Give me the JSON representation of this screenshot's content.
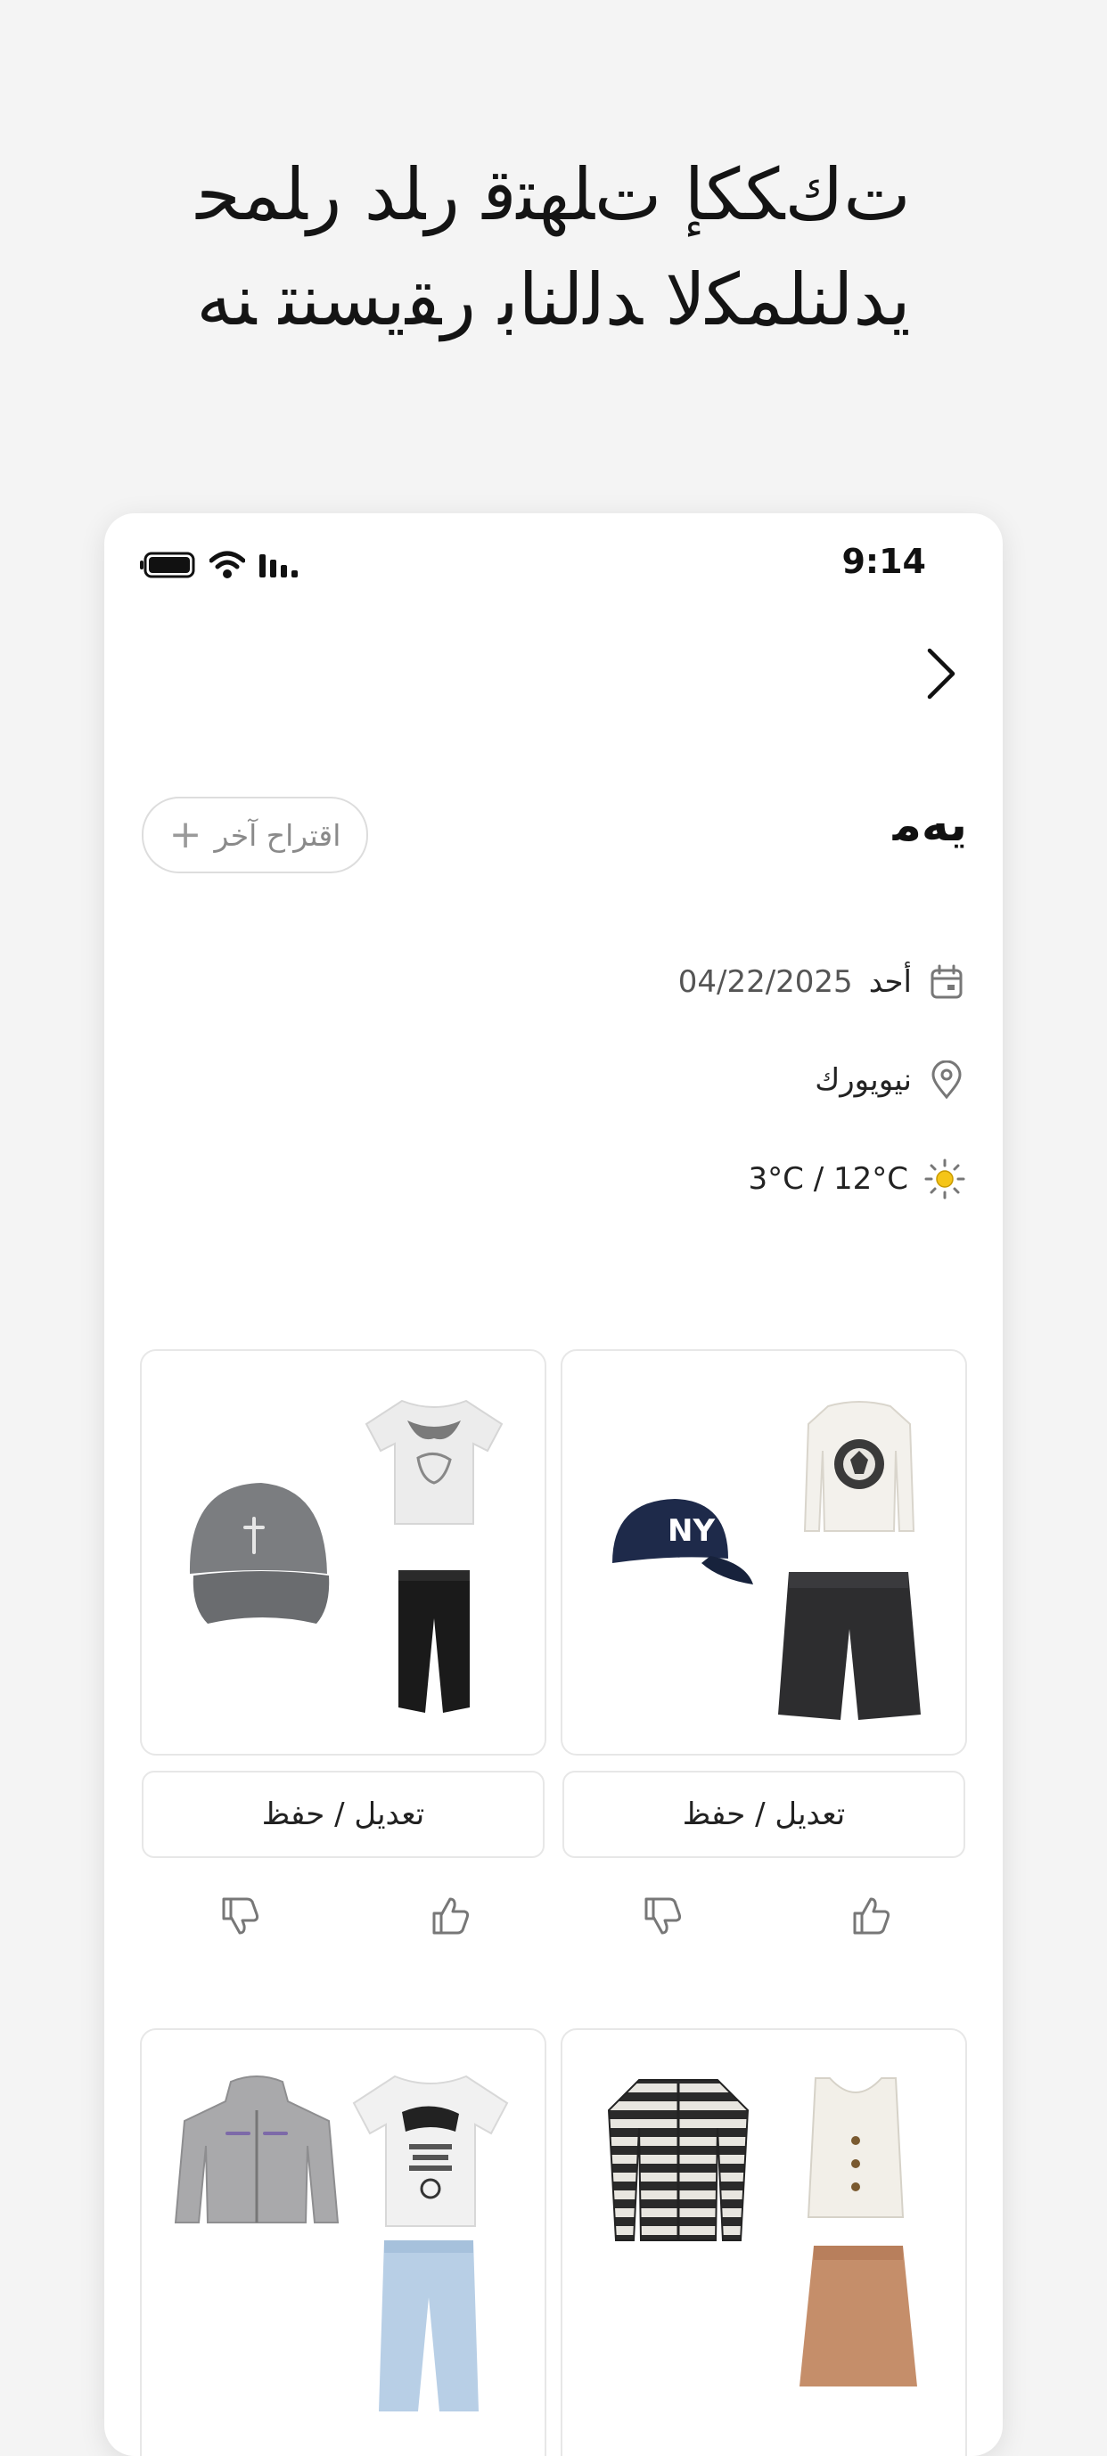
{
  "headline": {
    "line1": "ﺕﻙﻜﻜﺈ ﺕﻠﻬﺘﻗ ﺭﻠﺪ ﺭﻠﻤﺤ",
    "line2": "ﻳﺪﻟﻨﻠﻤﻜﻻ ﺪﻟﻟﻨﺎﺑ ﺭﻘﻳﺴﻨﺘ ﻨﻪ"
  },
  "status_bar": {
    "time": "9:14"
  },
  "section": {
    "title": "ﻳﻪﻣ",
    "suggest_button": "اقتراح آخر"
  },
  "info": {
    "date_day": "أحد",
    "date": "04/22/2025",
    "location": "نيويورك",
    "weather": "3°C / 12°C"
  },
  "outfit_cards": [
    {
      "edit_label": "تعديل / حفظ"
    },
    {
      "edit_label": "تعديل / حفظ"
    }
  ],
  "colors": {
    "background": "#f4f4f4",
    "card_border": "#e7e7e7",
    "sun": "#f5c518",
    "navy_cap": "#1e2a4a",
    "grey_cap": "#7b7d80"
  }
}
